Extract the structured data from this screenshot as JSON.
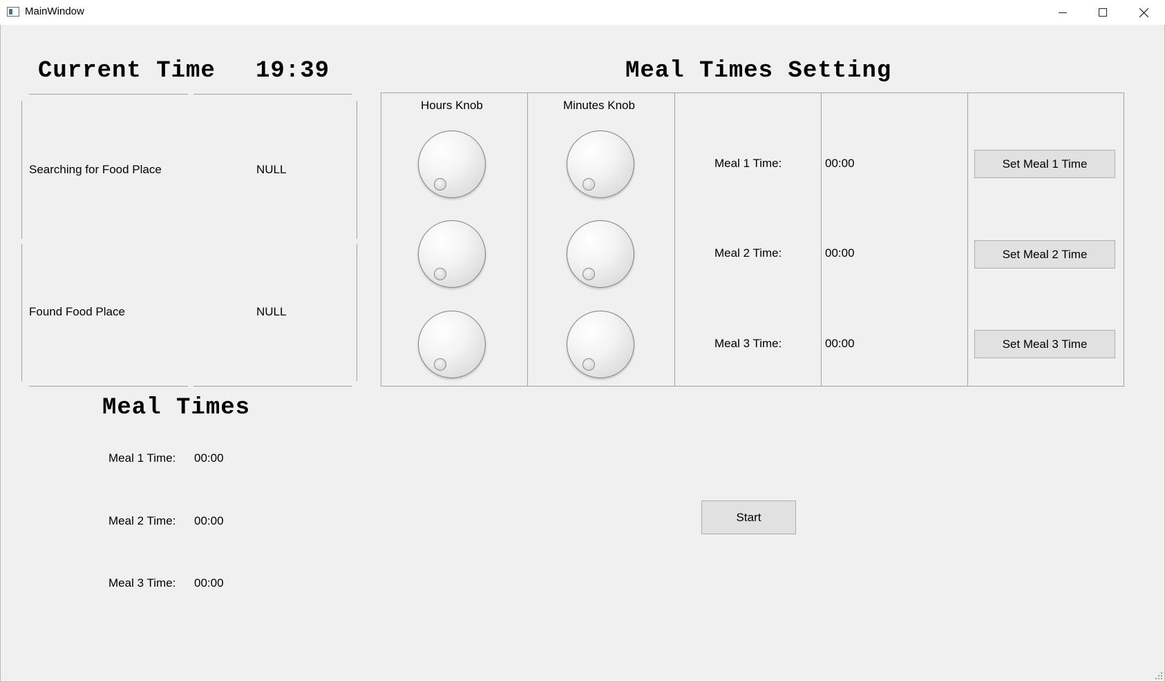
{
  "window": {
    "title": "MainWindow"
  },
  "current_time": {
    "label": "Current Time",
    "value": "19:39"
  },
  "status": [
    {
      "label": "Searching for Food Place",
      "value": "NULL"
    },
    {
      "label": "Found Food Place",
      "value": "NULL"
    }
  ],
  "meal_times": {
    "heading": "Meal Times",
    "rows": [
      {
        "label": "Meal 1 Time:",
        "value": "00:00"
      },
      {
        "label": "Meal 2 Time:",
        "value": "00:00"
      },
      {
        "label": "Meal 3 Time:",
        "value": "00:00"
      }
    ]
  },
  "setting": {
    "heading": "Meal Times Setting",
    "hours_knob_label": "Hours Knob",
    "minutes_knob_label": "Minutes Knob",
    "rows": [
      {
        "label": "Meal 1 Time:",
        "value": "00:00",
        "button": "Set Meal 1 Time",
        "hours": 0,
        "minutes": 0
      },
      {
        "label": "Meal 2 Time:",
        "value": "00:00",
        "button": "Set Meal 2 Time",
        "hours": 0,
        "minutes": 0
      },
      {
        "label": "Meal 3 Time:",
        "value": "00:00",
        "button": "Set Meal 3 Time",
        "hours": 0,
        "minutes": 0
      }
    ]
  },
  "start_button": "Start"
}
